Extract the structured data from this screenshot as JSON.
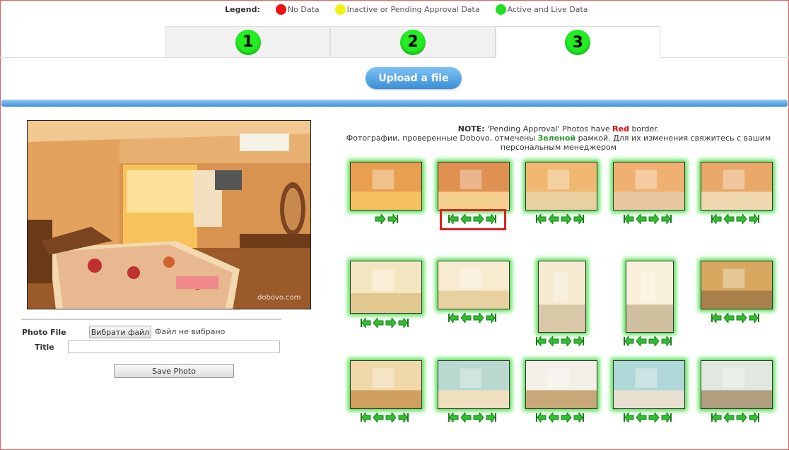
{
  "legend": {
    "title": "Legend:",
    "items": [
      {
        "label": "No Data",
        "color": "#ee1111"
      },
      {
        "label": "Inactive or Pending Approval Data",
        "color": "#f2f212"
      },
      {
        "label": "Active and Live Data",
        "color": "#22e022"
      }
    ]
  },
  "tabs": [
    {
      "number": "1",
      "active": false
    },
    {
      "number": "2",
      "active": false
    },
    {
      "number": "3",
      "active": true
    }
  ],
  "upload": {
    "label": "Upload a file"
  },
  "form": {
    "photo_file_label": "Photo File",
    "choose_file_button": "Вибрати файл",
    "file_status": "Файл не вибрано",
    "title_label": "Title",
    "title_value": "",
    "save_button": "Save Photo"
  },
  "note": {
    "prefix": "NOTE:",
    "part1": " 'Pending Approval' Photos have ",
    "red_word": "Red",
    "part2": " border.",
    "ru1": "Фотографии, проверенные Dobovo, отмечены ",
    "green_word": "Зеленой",
    "ru2": " рамкой. Для их изменения свяжитесь с вашим персональным менеджером"
  },
  "main_photo": {
    "watermark": "dobovo.com"
  },
  "thumbnails": {
    "count": 15,
    "status": "active"
  }
}
